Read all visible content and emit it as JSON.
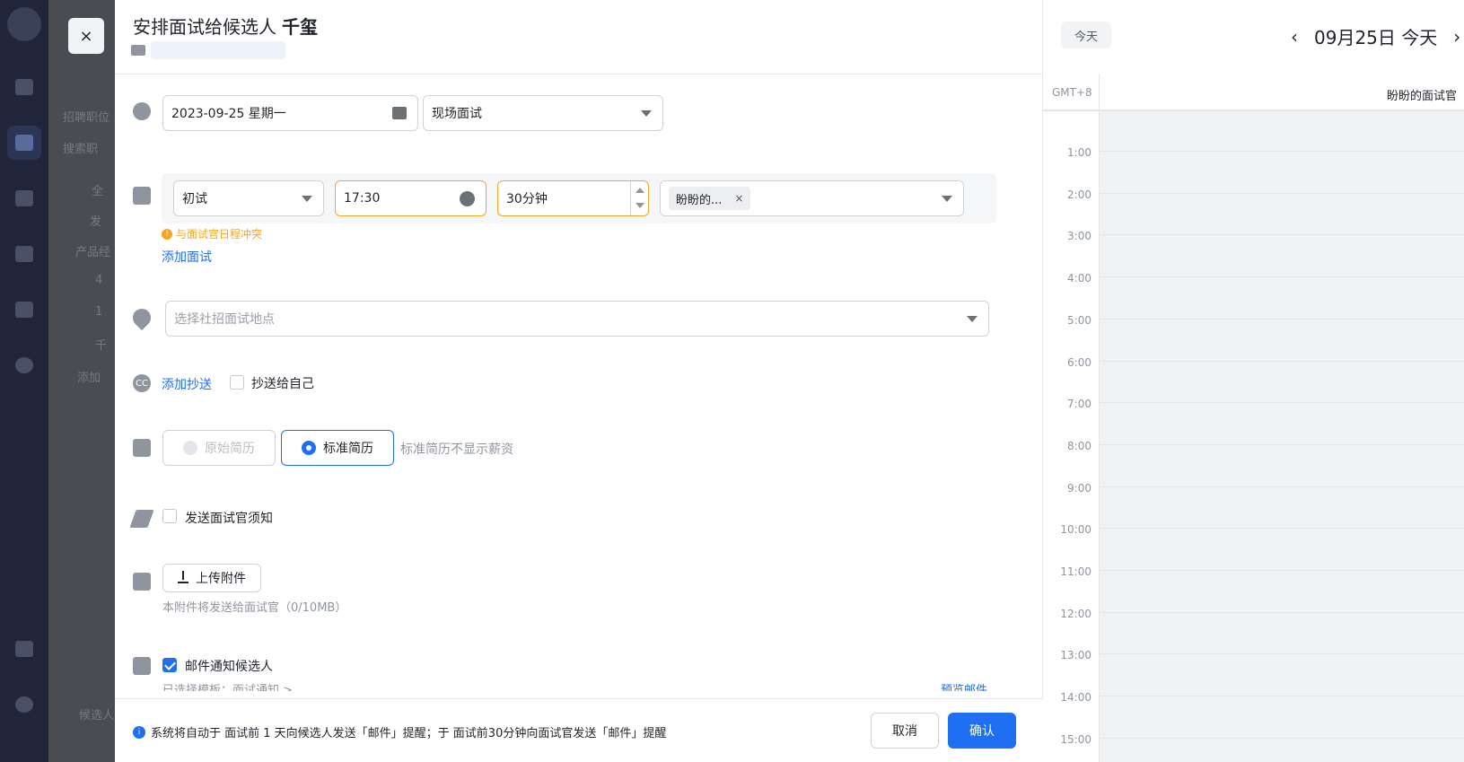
{
  "background": {
    "col2_snippets": [
      "招聘职位",
      "搜索职",
      "全",
      "发",
      "产品经",
      "4",
      "1",
      "千",
      "添加",
      "候选人"
    ]
  },
  "drawer": {
    "close_label": "×",
    "title_prefix": "安排面试给候选人",
    "candidate_name": "千玺",
    "time_row": {
      "date_value": "2023-09-25 星期一",
      "type_value": "现场面试"
    },
    "interview_row": {
      "round_value": "初试",
      "start_time": "17:30",
      "duration": "30分钟",
      "interviewer_tag": "盼盼的...",
      "tag_remove": "×",
      "conflict_warning": "与面试官日程冲突",
      "conflict_icon": "!"
    },
    "add_interview": "添加面试",
    "location": {
      "placeholder": "选择社招面试地点"
    },
    "cc": {
      "icon_text": "CC",
      "add_cc": "添加抄送",
      "cc_self": "抄送给自己"
    },
    "resume": {
      "original": "原始简历",
      "standard": "标准简历",
      "hint": "标准简历不显示薪资"
    },
    "notice": {
      "label": "发送面试官须知"
    },
    "attachment": {
      "button": "上传附件",
      "hint": "本附件将发送给面试官（0/10MB）"
    },
    "email": {
      "label": "邮件通知候选人",
      "template_line": "已选择模板：面试通知 >",
      "preview": "预览邮件"
    },
    "footer": {
      "info_icon": "i",
      "info": "系统将自动于 面试前 1 天向候选人发送「邮件」提醒；于 面试前30分钟向面试官发送「邮件」提醒",
      "cancel": "取消",
      "confirm": "确认"
    }
  },
  "calendar": {
    "today_button": "今天",
    "prev": "‹",
    "next": "›",
    "date_title": "09月25日 今天",
    "timezone": "GMT+8",
    "column_title": "盼盼的面试官",
    "hours": [
      "1:00",
      "2:00",
      "3:00",
      "4:00",
      "5:00",
      "6:00",
      "7:00",
      "8:00",
      "9:00",
      "10:00",
      "11:00",
      "12:00",
      "13:00",
      "14:00",
      "15:00"
    ]
  },
  "colors": {
    "primary": "#1e6ff1",
    "warning": "#f5a623",
    "rail": "#20253a"
  },
  "icons": [
    "clock-icon",
    "calendar-icon",
    "location-icon",
    "cc-icon",
    "document-icon",
    "send-icon",
    "folder-icon",
    "mail-icon",
    "upload-icon",
    "info-icon",
    "close-icon"
  ]
}
